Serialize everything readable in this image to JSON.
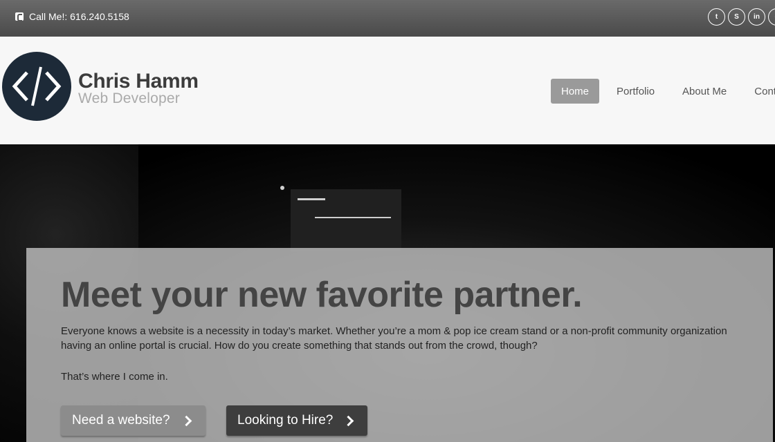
{
  "topbar": {
    "phone_text": "Call Me!: 616.240.5158",
    "socials": [
      {
        "name": "twitter-icon",
        "glyph": "t"
      },
      {
        "name": "skype-icon",
        "glyph": "S"
      },
      {
        "name": "linkedin-icon",
        "glyph": "in"
      },
      {
        "name": "github-icon",
        "glyph": "g"
      }
    ]
  },
  "header": {
    "logo_glyph": "</>",
    "brand_name": "Chris Hamm",
    "brand_tagline": "Web Developer",
    "nav": [
      "Home",
      "Portfolio",
      "About Me",
      "Contact"
    ]
  },
  "hero": {
    "headline": "Meet your new favorite partner.",
    "paragraph": "Everyone knows a website is a necessity in today’s market.  Whether you’re a mom & pop ice cream stand or a non-profit community organization having an online portal is crucial.  How do you create something that stands out from the crowd, though?",
    "paragraph2": "That’s where I come in.",
    "button_website": "Need a website?",
    "button_hire": "Looking to Hire?"
  },
  "colors": {
    "logo_bg": "#1d2a38",
    "nav_active": "#9a9a9a",
    "button_light": "#8c8c8c",
    "button_dark": "#3e3e3e"
  }
}
